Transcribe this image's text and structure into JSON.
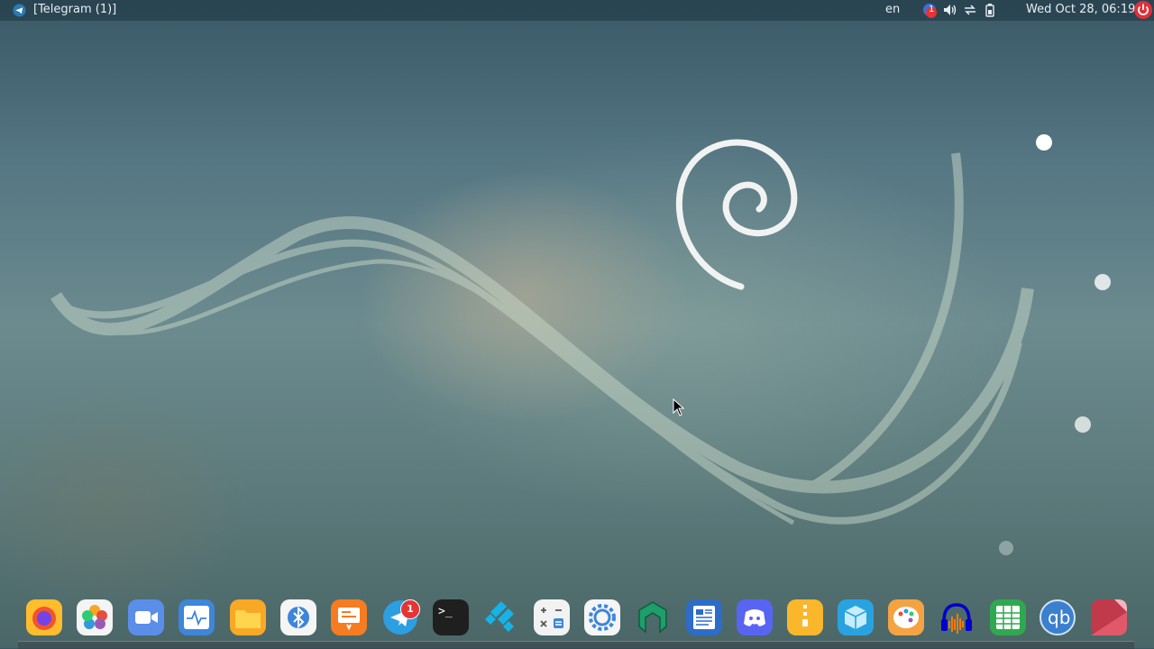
{
  "topbar": {
    "window_title": "[Telegram (1)]",
    "keyboard_layout": "en",
    "tray": {
      "notification_count": "1",
      "icons": [
        "notification-icon",
        "volume-icon",
        "network-icon",
        "battery-icon"
      ]
    },
    "clock": "Wed Oct 28, 06:19"
  },
  "dock": {
    "items": [
      {
        "name": "firefox",
        "icon": "firefox-icon"
      },
      {
        "name": "photos",
        "icon": "photos-icon"
      },
      {
        "name": "video-call",
        "icon": "camera-icon"
      },
      {
        "name": "system-monitor",
        "icon": "monitor-icon"
      },
      {
        "name": "files",
        "icon": "folder-icon"
      },
      {
        "name": "bluetooth",
        "icon": "bluetooth-icon"
      },
      {
        "name": "presentation",
        "icon": "presentation-icon"
      },
      {
        "name": "telegram",
        "icon": "telegram-icon",
        "badge": "1"
      },
      {
        "name": "terminal",
        "icon": "terminal-icon",
        "glyph": ">_"
      },
      {
        "name": "kodi",
        "icon": "kodi-icon"
      },
      {
        "name": "calculator",
        "icon": "calculator-icon"
      },
      {
        "name": "settings",
        "icon": "gear-icon"
      },
      {
        "name": "octopi",
        "icon": "octopi-icon"
      },
      {
        "name": "text-editor",
        "icon": "document-icon"
      },
      {
        "name": "discord",
        "icon": "discord-icon"
      },
      {
        "name": "archive-manager",
        "icon": "archive-icon"
      },
      {
        "name": "package-manager",
        "icon": "box-icon"
      },
      {
        "name": "paint",
        "icon": "palette-icon"
      },
      {
        "name": "audacity",
        "icon": "audacity-icon"
      },
      {
        "name": "spreadsheet",
        "icon": "spreadsheet-icon"
      },
      {
        "name": "qbittorrent",
        "icon": "qbittorrent-icon",
        "glyph": "qb"
      },
      {
        "name": "document-viewer",
        "icon": "document-viewer-icon"
      }
    ]
  },
  "colors": {
    "topbar_bg": "#1e3442",
    "badge": "#e43434",
    "power": "#e0303a"
  }
}
